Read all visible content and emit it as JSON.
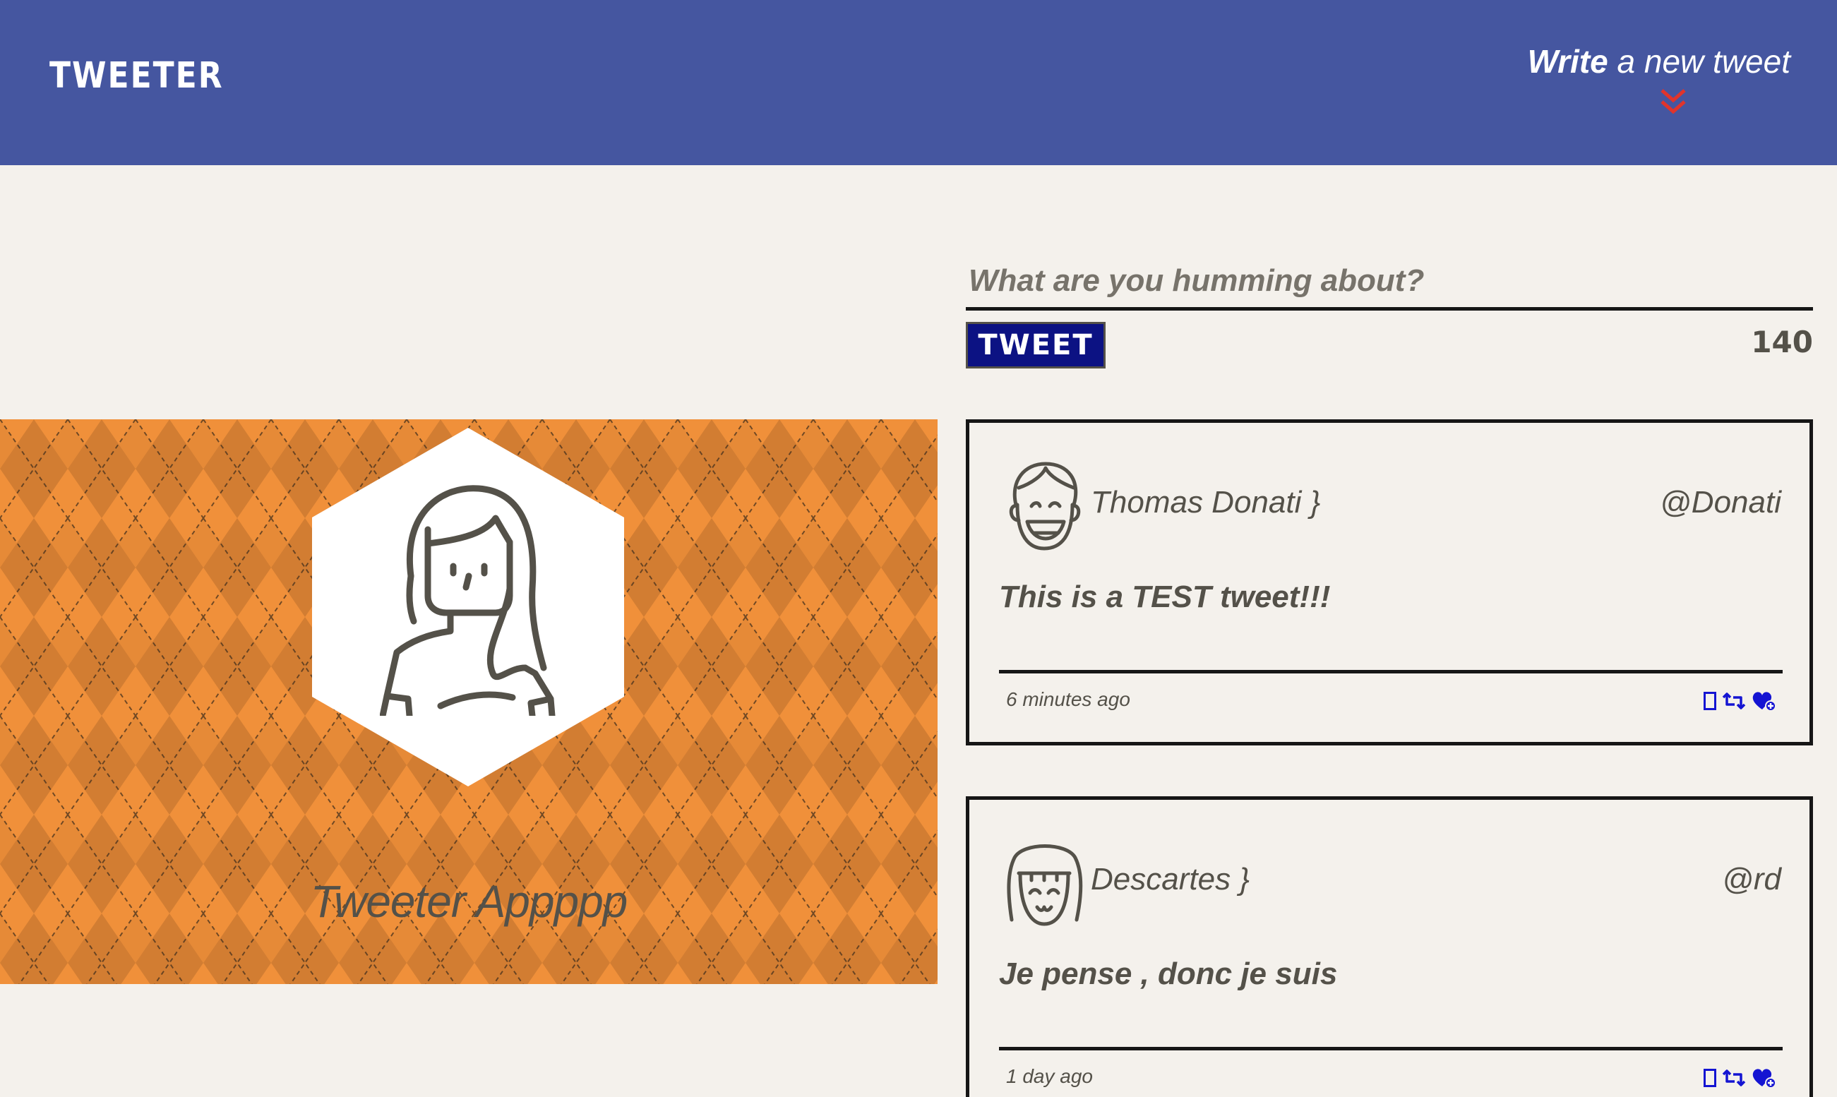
{
  "nav": {
    "brand": "TWEETER",
    "compose_bold": "Write",
    "compose_rest": " a new tweet"
  },
  "banner": {
    "title": "Tweeter Appppp"
  },
  "composer": {
    "placeholder": "What are you humming about?",
    "submit_label": "TWEET",
    "char_count": "140"
  },
  "tweets": [
    {
      "name": "Thomas Donati }",
      "handle": "@Donati",
      "content": "This is a TEST tweet!!!",
      "time": "6 minutes ago"
    },
    {
      "name": "Descartes }",
      "handle": "@rd",
      "content": "Je pense , donc je suis",
      "time": "1 day ago"
    }
  ],
  "colors": {
    "nav_bg": "#4556a0",
    "page_bg": "#f4f1ec",
    "accent_red": "#e0342c",
    "button_bg": "#0c1283",
    "action_blue": "#1414d2",
    "banner_orange": "#f0903a"
  },
  "icons": [
    "double-chevron-down-icon",
    "flag-icon",
    "retweet-icon",
    "heart-icon"
  ]
}
